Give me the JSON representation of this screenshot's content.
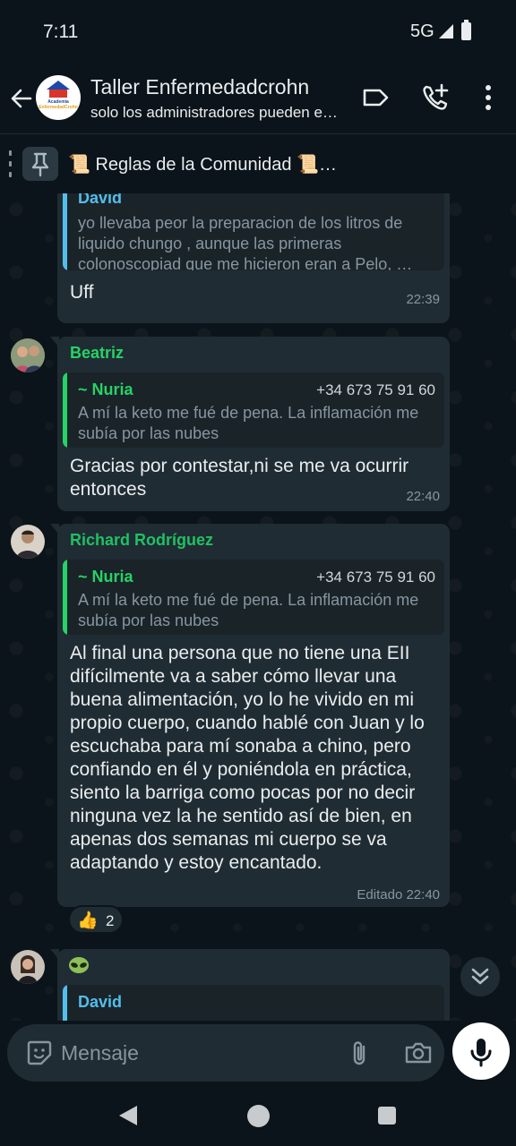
{
  "status_bar": {
    "time": "7:11",
    "network": "5G"
  },
  "header": {
    "title": "Taller Enfermedadcrohn",
    "subtitle": "solo los administradores pueden e…",
    "avatar_text_1": "Academia",
    "avatar_text_2": "EnfermedadCrohn"
  },
  "pinned": {
    "text": "📜 Reglas de la Comunidad 📜…"
  },
  "messages": [
    {
      "quote_author": "David",
      "quote_text": "yo llevaba peor la preparacion de los litros de liquido chungo , aunque las primeras colonoscopiad que me hicieron eran a Pelo, …",
      "text": "Uff",
      "time": "22:39"
    },
    {
      "sender": "Beatriz",
      "quote_author": "~ Nuria",
      "quote_phone": "+34 673 75 91 60",
      "quote_text": "A mí la keto me fué de pena. La inflamación me subía por las nubes",
      "text": "Gracias por contestar,ni se me va ocurrir entonces",
      "time": "22:40"
    },
    {
      "sender": "Richard Rodríguez",
      "quote_author": "~ Nuria",
      "quote_phone": "+34 673 75 91 60",
      "quote_text": "A mí la keto me fué de pena. La inflamación me subía por las nubes",
      "text": "Al final una persona que no tiene una EII difícilmente va a saber cómo llevar una buena alimentación, yo lo he vivido en mi propio cuerpo, cuando hablé con Juan y lo escuchaba para mí sonaba a chino, pero confiando en él y poniéndola en práctica, siento la barriga como pocas por no decir ninguna vez la he sentido así de bien, en apenas dos semanas mi cuerpo se va adaptando y estoy encantado.",
      "time": "Editado 22:40",
      "reaction_emoji": "👍",
      "reaction_count": "2"
    },
    {
      "sender_emoji": "alien",
      "quote_author": "David"
    }
  ],
  "input": {
    "placeholder": "Mensaje"
  },
  "colors": {
    "beatriz": "#25d366",
    "richard": "#21c063",
    "david": "#53bdeb",
    "nuria": "#25d366"
  }
}
